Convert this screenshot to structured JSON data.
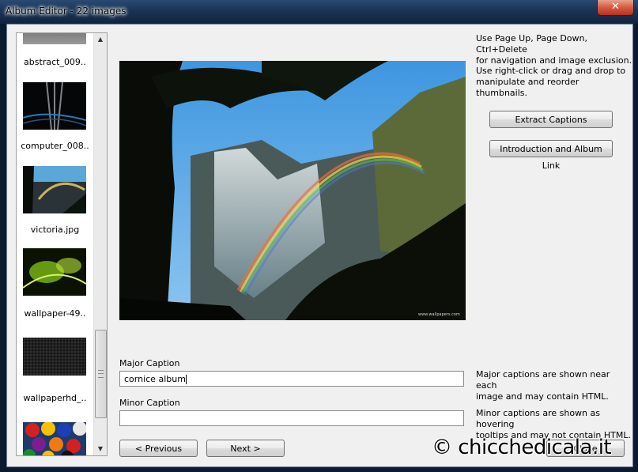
{
  "window": {
    "title": "Album Editor  -  22 images",
    "close_glyph": "✕"
  },
  "thumbnails": [
    {
      "caption": "abstract_009..",
      "icon": "abstract-thumbnail",
      "selected": false
    },
    {
      "caption": "computer_008..",
      "icon": "computer-thumbnail",
      "selected": false
    },
    {
      "caption": "victoria.jpg",
      "icon": "victoria-falls-thumbnail",
      "selected": true
    },
    {
      "caption": "wallpaper-49..",
      "icon": "green-abstract-thumbnail",
      "selected": false
    },
    {
      "caption": "wallpaperhd_..",
      "icon": "dark-texture-thumbnail",
      "selected": false
    },
    {
      "caption": "",
      "icon": "billiard-balls-thumbnail",
      "selected": false
    }
  ],
  "scroll": {
    "up_glyph": "▲",
    "down_glyph": "▼"
  },
  "help": {
    "navigation": [
      "Use Page Up, Page Down, Ctrl+Delete",
      "for navigation and image exclusion."
    ],
    "manipulate": [
      "Use right-click or drag and drop to",
      "manipulate and reorder thumbnails."
    ],
    "major_note": [
      "Major captions are shown near each",
      "image and may contain HTML."
    ],
    "minor_note": [
      "Minor captions are shown as hovering",
      "tooltips and may not contain HTML."
    ]
  },
  "buttons": {
    "extract": "Extract Captions",
    "intro": "Introduction and Album Link",
    "previous": "< Previous",
    "next": "Next >",
    "close": "Close"
  },
  "fields": {
    "major_label": "Major Caption",
    "major_value": "cornice album",
    "minor_label": "Minor Caption",
    "minor_value": ""
  },
  "preview": {
    "credit": "www.wallpapers.com"
  },
  "watermark": "© chicchedicala.it"
}
